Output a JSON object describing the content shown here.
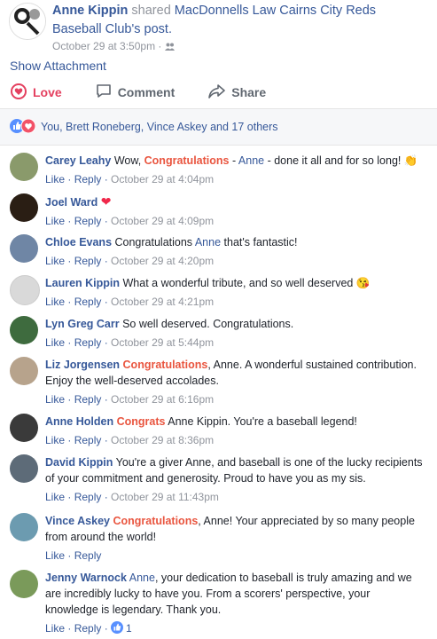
{
  "post": {
    "author": "Anne Kippin",
    "shared_word": "shared",
    "page_name": "MacDonnells Law Cairns City Reds Baseball Club",
    "post_suffix": "'s post.",
    "timestamp": "October 29 at 3:50pm",
    "show_attachment": "Show Attachment"
  },
  "actions": {
    "love": "Love",
    "comment": "Comment",
    "share": "Share"
  },
  "reactions": {
    "summary": "You, Brett Roneberg, Vince Askey and 17 others"
  },
  "comments": [
    {
      "name": "Carey Leahy",
      "parts": [
        " Wow, ",
        "Congratulations",
        " - ",
        "Anne",
        " - done it all and for so long! "
      ],
      "emoji": "👏",
      "time": "October 29 at 4:04pm",
      "like": "Like",
      "reply": "Reply",
      "avatar_color": "#8a9a6b"
    },
    {
      "name": "Joel Ward",
      "parts": [],
      "emoji": "❤",
      "time": "October 29 at 4:09pm",
      "like": "Like",
      "reply": "Reply",
      "avatar_color": "#2a1e14"
    },
    {
      "name": "Chloe Evans",
      "parts": [
        " Congratulations ",
        "Anne",
        " that's fantastic!"
      ],
      "time": "October 29 at 4:20pm",
      "like": "Like",
      "reply": "Reply",
      "avatar_color": "#6f86a5"
    },
    {
      "name": "Lauren Kippin",
      "parts": [
        " What a wonderful tribute, and so well deserved "
      ],
      "emoji": "😘",
      "time": "October 29 at 4:21pm",
      "like": "Like",
      "reply": "Reply",
      "avatar_color": "#d9d9d9"
    },
    {
      "name": "Lyn Greg Carr",
      "parts": [
        " So well deserved. Congratulations."
      ],
      "time": "October 29 at 5:44pm",
      "like": "Like",
      "reply": "Reply",
      "avatar_color": "#3e6b3e"
    },
    {
      "name": "Liz Jorgensen",
      "parts": [
        " ",
        "Congratulations",
        ", Anne. A wonderful sustained contribution. Enjoy the well-deserved accolades."
      ],
      "time": "October 29 at 6:16pm",
      "like": "Like",
      "reply": "Reply",
      "avatar_color": "#b7a38c"
    },
    {
      "name": "Anne Holden",
      "parts": [
        " ",
        "Congrats",
        " Anne Kippin. You're a baseball legend!"
      ],
      "time": "October 29 at 8:36pm",
      "like": "Like",
      "reply": "Reply",
      "avatar_color": "#3a3a3a"
    },
    {
      "name": "David Kippin",
      "parts": [
        " You're a giver Anne, and baseball is one of the lucky recipients of your commitment and generosity. Proud to have you as my sis."
      ],
      "time": "October 29 at 11:43pm",
      "like": "Like",
      "reply": "Reply",
      "avatar_color": "#5d6b78"
    },
    {
      "name": "Vince Askey",
      "parts": [
        " ",
        "Congratulations",
        ", Anne! Your appreciated by so many people from around the world!"
      ],
      "time": "",
      "like": "Like",
      "reply": "Reply",
      "avatar_color": "#6c9bb0"
    },
    {
      "name": "Jenny Warnock",
      "parts": [
        " ",
        "Anne",
        ", your dedication to baseball is truly amazing and we are incredibly lucky to have you. From a scorers' perspective, your knowledge is legendary. Thank you."
      ],
      "time": "",
      "like": "Like",
      "reply": "Reply",
      "like_count": "1",
      "avatar_color": "#7a9a5a"
    }
  ],
  "meta_sep": " · "
}
